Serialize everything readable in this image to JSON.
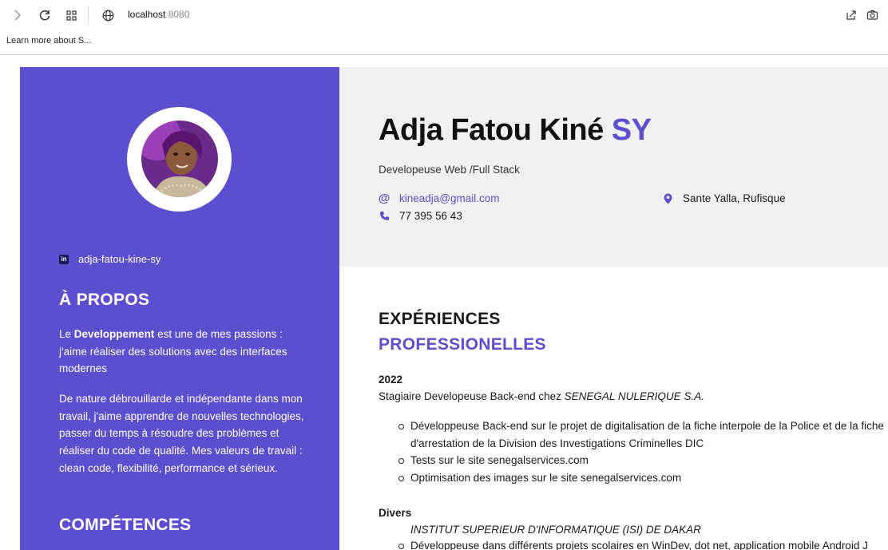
{
  "browser": {
    "url_host": "localhost",
    "url_port": ":8080",
    "bookmark_label": "Learn more about S...",
    "icons": [
      "forward-icon",
      "reload-icon",
      "apps-grid-icon",
      "site-info-icon",
      "share-icon",
      "screenshot-icon"
    ]
  },
  "profile": {
    "first_names": "Adja Fatou Kiné",
    "last_name": "SY",
    "role": "Developeuse Web /Full Stack",
    "email": "kineadja@gmail.com",
    "phone": "77 395 56 43",
    "location": "Sante Yalla, Rufisque",
    "linkedin": "adja-fatou-kine-sy",
    "accent_color": "#5b4fcf"
  },
  "sidebar": {
    "about_title": "À PROPOS",
    "about_p1_prefix": "Le ",
    "about_p1_bold": "Developpement",
    "about_p1_suffix": " est une de mes passions : j'aime réaliser des solutions avec des interfaces modernes",
    "about_p2": "De nature débrouillarde et indépendante dans mon travail, j'aime apprendre de nouvelles technologies, passer du temps à résoudre des problèmes et réaliser du code de qualité. Mes valeurs de travail : clean code, flexibilité, performance et sérieux.",
    "skills_title": "COMPÉTENCES"
  },
  "experience": {
    "title_line1": "EXPÉRIENCES",
    "title_line2": "PROFESSIONELLES",
    "jobs": [
      {
        "year": "2022",
        "position_prefix": "Stagiaire Developeuse Back-end chez ",
        "company": "SENEGAL NULERIQUE S.A.",
        "bullets": [
          "Développeuse Back-end sur le projet de digitalisation de la fiche interpole de la Police et de la fiche",
          "d'arrestation de la Division des Investigations Criminelles DIC",
          "Tests sur le site senegalservices.com",
          "Optimisation des images sur le site senegalservices.com"
        ]
      },
      {
        "year": "Divers",
        "company": "INSTITUT SUPERIEUR D'INFORMATIQUE (ISI) DE DAKAR",
        "bullets": [
          "Développeuse dans différents projets scolaires en WinDev, dot net, application mobile Android J"
        ]
      }
    ]
  }
}
